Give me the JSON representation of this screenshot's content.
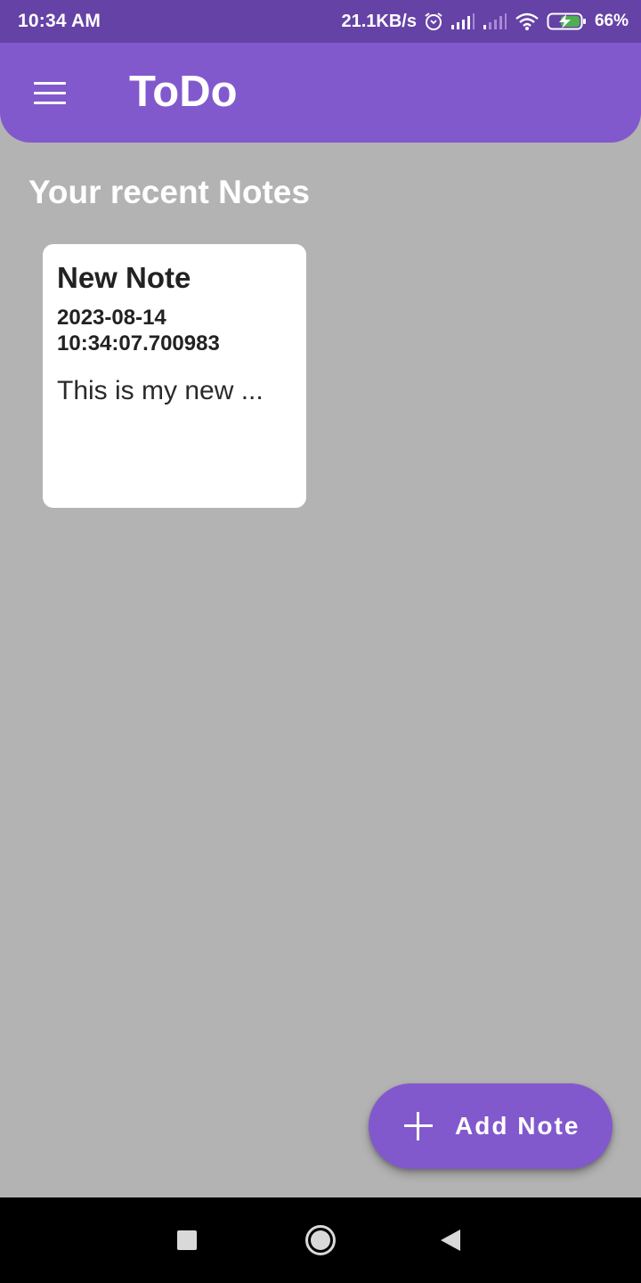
{
  "status_bar": {
    "time": "10:34 AM",
    "network_speed": "21.1KB/s",
    "battery_percent": "66%",
    "icons": [
      "alarm-icon",
      "signal-icon",
      "signal-icon",
      "wifi-icon",
      "battery-charging-icon"
    ]
  },
  "app_bar": {
    "title": "ToDo",
    "menu_icon": "hamburger-menu-icon"
  },
  "main": {
    "section_heading": "Your recent Notes",
    "notes": [
      {
        "title": "New Note",
        "date": "2023-08-14 10:34:07.700983",
        "preview": "This is my new ..."
      }
    ]
  },
  "fab": {
    "icon": "plus-icon",
    "label": "Add Note"
  },
  "nav_bar": {
    "icons": [
      "recent-apps-icon",
      "home-icon",
      "back-icon"
    ]
  },
  "colors": {
    "status_bar": "#6542a6",
    "app_bar": "#8259cc",
    "background": "#b3b3b3",
    "card": "#ffffff",
    "fab": "#8259cc",
    "nav_bar": "#000000"
  }
}
